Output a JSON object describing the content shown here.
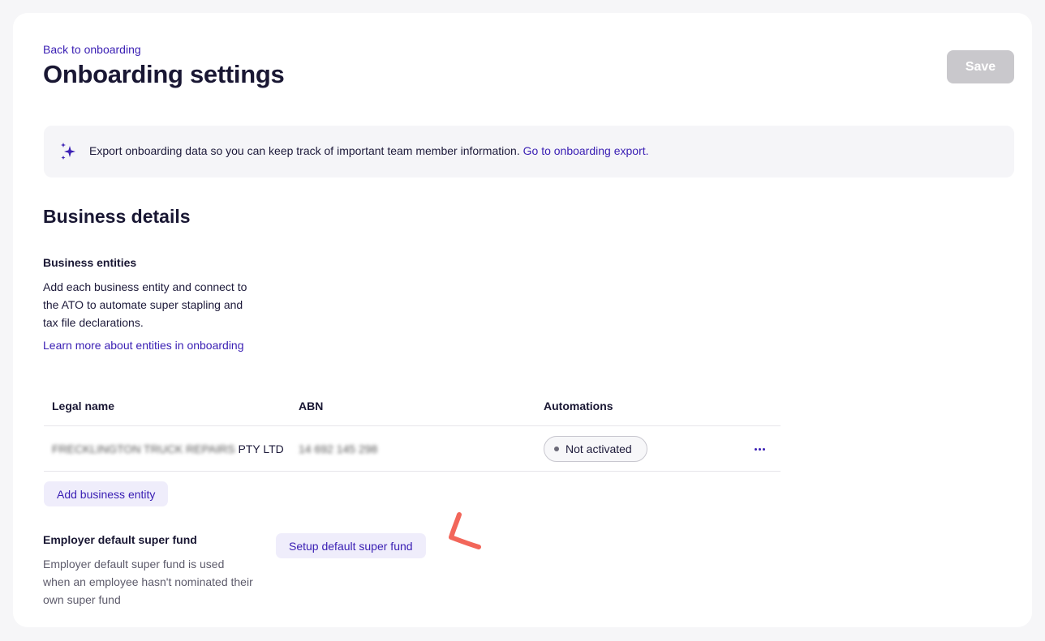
{
  "header": {
    "back_link": "Back to onboarding",
    "title": "Onboarding settings",
    "save_label": "Save"
  },
  "banner": {
    "icon": "sparkles-icon",
    "text": "Export onboarding data so you can keep track of important team member information.",
    "link": "Go to onboarding export."
  },
  "business_details": {
    "title": "Business details",
    "entities": {
      "title": "Business entities",
      "description": "Add each business entity and connect to the ATO to automate super stapling and tax file declarations.",
      "learn_link": "Learn more about entities in onboarding"
    },
    "table": {
      "columns": [
        "Legal name",
        "ABN",
        "Automations"
      ],
      "rows": [
        {
          "legal_name_blurred": "FRECKLINGTON TRUCK REPAIRS",
          "legal_name_suffix": "PTY LTD",
          "abn": "14 692 145 298",
          "automations": "Not activated"
        }
      ]
    },
    "add_entity_label": "Add business entity"
  },
  "super_fund": {
    "title": "Employer default super fund",
    "description": "Employer default super fund is used when an employee hasn't nominated their own super fund",
    "setup_label": "Setup default super fund"
  },
  "colors": {
    "accent": "#3b20b4",
    "annotation": "#f2665a",
    "save_disabled": "#c9c8cc"
  }
}
